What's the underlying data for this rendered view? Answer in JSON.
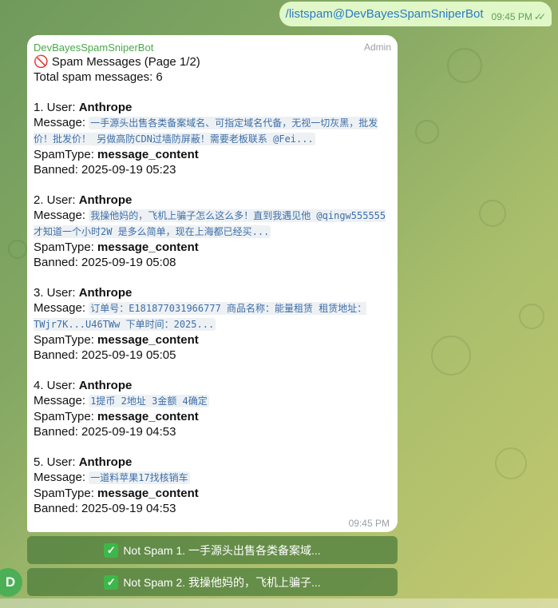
{
  "outgoing": {
    "command": "/listspam@DevBayesSpamSniperBot",
    "time": "09:45 PM"
  },
  "bot_message": {
    "sender": "DevBayesSpamSniperBot",
    "role": "Admin",
    "title_icon": "🚫",
    "title": "Spam Messages (Page 1/2)",
    "total": "Total spam messages: 6",
    "time": "09:45 PM",
    "entries": [
      {
        "index": "1. User: ",
        "user": "Anthrope",
        "message_label": "Message: ",
        "message": "一手源头出售各类备案域名、可指定域名代备，无视一切灰黑，批发价！批发价！ 另做高防CDN过墙防屏蔽！需要老板联系 @Fei...",
        "spamtype_label": "SpamType: ",
        "spamtype": "message_content",
        "banned": "Banned: 2025-09-19 05:23"
      },
      {
        "index": "2. User: ",
        "user": "Anthrope",
        "message_label": "Message: ",
        "message": "我操他妈的，飞机上骗子怎么这么多！直到我遇见他 @qingw555555 才知道一个小时2W 是多么简单，现在上海都已经买...",
        "spamtype_label": "SpamType: ",
        "spamtype": "message_content",
        "banned": "Banned: 2025-09-19 05:08"
      },
      {
        "index": "3. User: ",
        "user": "Anthrope",
        "message_label": "Message: ",
        "message": "订单号：E181877031966777 商品名称：能量租赁 租赁地址：TWjr7K...U46TWw 下单时间：2025...",
        "spamtype_label": "SpamType: ",
        "spamtype": "message_content",
        "banned": "Banned: 2025-09-19 05:05"
      },
      {
        "index": "4. User: ",
        "user": "Anthrope",
        "message_label": "Message: ",
        "message": "1提币 2地址 3金额 4确定",
        "spamtype_label": "SpamType: ",
        "spamtype": "message_content",
        "banned": "Banned: 2025-09-19 04:53"
      },
      {
        "index": "5. User: ",
        "user": "Anthrope",
        "message_label": "Message: ",
        "message": "一道料苹果17找核销车",
        "spamtype_label": "SpamType: ",
        "spamtype": "message_content",
        "banned": "Banned: 2025-09-19 04:53"
      }
    ]
  },
  "keyboard": {
    "buttons": [
      {
        "icon": "✓",
        "label": "Not Spam 1. 一手源头出售各类备案域..."
      },
      {
        "icon": "✓",
        "label": "Not Spam 2. 我操他妈的，飞机上骗子..."
      }
    ]
  },
  "avatar": {
    "initial": "D",
    "color": "#4cae55"
  },
  "colors": {
    "outgoing_bubble": "#e0f7c8",
    "link": "#2a7cc8",
    "sender": "#4aa94a",
    "code": "#3d6fa8",
    "keyboard_button": "#4a7a3a"
  }
}
